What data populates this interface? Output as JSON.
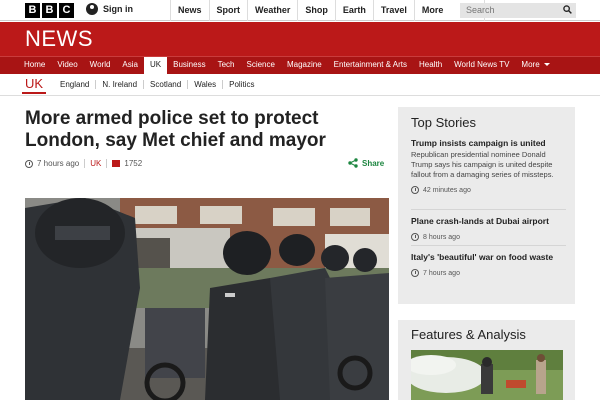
{
  "masthead": {
    "logo_letters": [
      "B",
      "B",
      "C"
    ],
    "signin_label": "Sign in",
    "nav": [
      "News",
      "Sport",
      "Weather",
      "Shop",
      "Earth",
      "Travel",
      "More"
    ],
    "search_placeholder": "Search"
  },
  "news_band": {
    "title": "NEWS"
  },
  "section_nav": {
    "items": [
      "Home",
      "Video",
      "World",
      "Asia",
      "UK",
      "Business",
      "Tech",
      "Science",
      "Magazine",
      "Entertainment & Arts",
      "Health",
      "World News TV",
      "More"
    ],
    "active": "UK"
  },
  "sub_nav": {
    "current": "UK",
    "items": [
      "England",
      "N. Ireland",
      "Scotland",
      "Wales",
      "Politics"
    ]
  },
  "article": {
    "headline": "More armed police set to protect London, say Met chief and mayor",
    "time": "7 hours ago",
    "section": "UK",
    "comments": "1752",
    "share_label": "Share"
  },
  "top_stories": {
    "title": "Top Stories",
    "stories": [
      {
        "title": "Trump insists campaign is united",
        "summary": "Republican presidential nominee Donald Trump says his campaign is united despite fallout from a damaging series of missteps.",
        "time": "42 minutes ago"
      },
      {
        "title": "Plane crash-lands at Dubai airport",
        "summary": "",
        "time": "8 hours ago"
      },
      {
        "title": "Italy's 'beautiful' war on food waste",
        "summary": "",
        "time": "7 hours ago"
      }
    ]
  },
  "features": {
    "title": "Features & Analysis"
  },
  "colors": {
    "brand_red": "#bb1919",
    "share_green": "#1d8640",
    "sidebar_bg": "#ebebeb"
  },
  "icons": [
    "search-icon",
    "user-icon",
    "clock-icon",
    "comment-icon",
    "share-icon"
  ]
}
